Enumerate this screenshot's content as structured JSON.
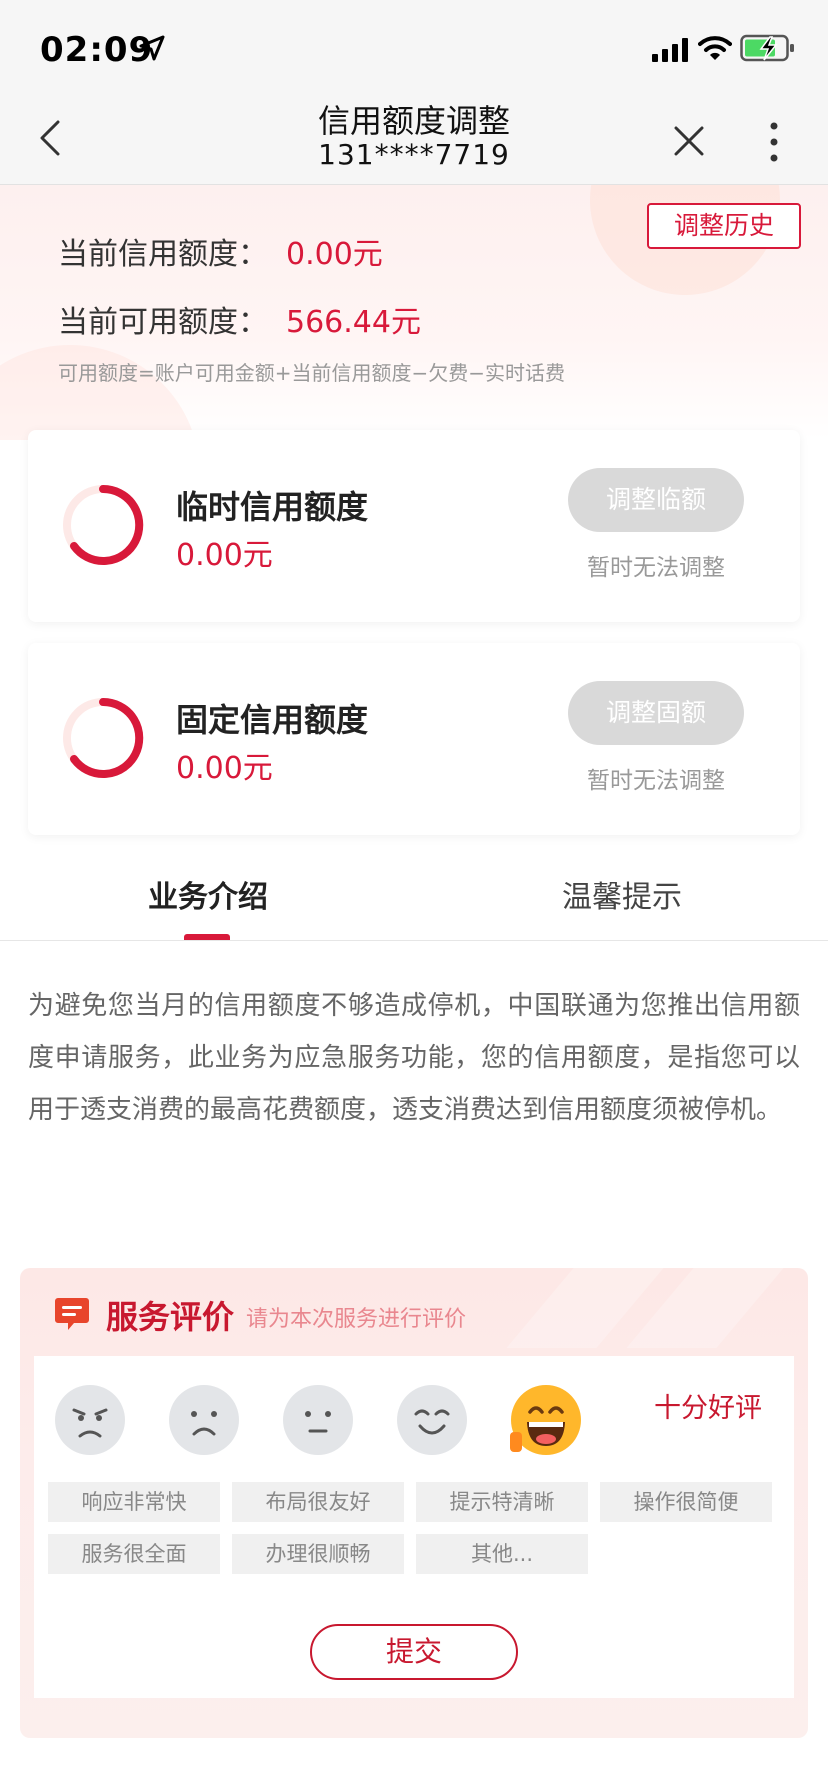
{
  "status_bar": {
    "time": "02:09"
  },
  "nav": {
    "title": "信用额度调整",
    "subtitle": "131****7719"
  },
  "summary": {
    "history_button": "调整历史",
    "current_credit_label": "当前信用额度：",
    "current_credit_value": "0.00元",
    "available_label": "当前可用额度：",
    "available_value": "566.44元",
    "formula": "可用额度=账户可用金额+当前信用额度−欠费−实时话费"
  },
  "cards": [
    {
      "title": "临时信用额度",
      "amount": "0.00元",
      "button": "调整临额",
      "note": "暂时无法调整"
    },
    {
      "title": "固定信用额度",
      "amount": "0.00元",
      "button": "调整固额",
      "note": "暂时无法调整"
    }
  ],
  "tabs": [
    {
      "label": "业务介绍",
      "active": true
    },
    {
      "label": "温馨提示",
      "active": false
    }
  ],
  "intro": "为避免您当月的信用额度不够造成停机，中国联通为您推出信用额度申请服务，此业务为应急服务功能，您的信用额度，是指您可以用于透支消费的最高花费额度，透支消费达到信用额度须被停机。",
  "evaluation": {
    "title": "服务评价",
    "subtitle": "请为本次服务进行评价",
    "faces": [
      "angry-face-icon",
      "sad-face-icon",
      "neutral-face-icon",
      "smile-face-icon",
      "grin-face-icon"
    ],
    "selected_face": 5,
    "rating_label": "十分好评",
    "tags": [
      "响应非常快",
      "布局很友好",
      "提示特清晰",
      "操作很简便",
      "服务很全面",
      "办理很顺畅",
      "其他..."
    ],
    "submit": "提交"
  },
  "colors": {
    "accent": "#d8193a",
    "disabled_button": "#d9d9d9",
    "muted_text": "#999999"
  }
}
